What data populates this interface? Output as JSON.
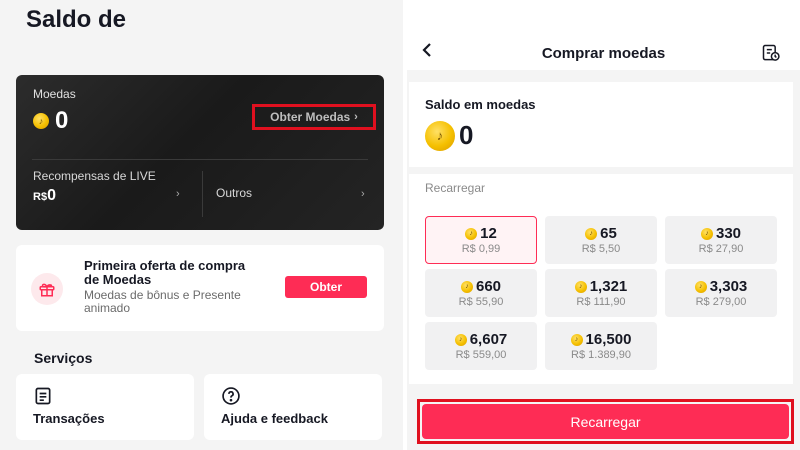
{
  "left": {
    "title": "Saldo de",
    "wallet": {
      "coins_label": "Moedas",
      "coins_value": "0",
      "get_coins_label": "Obter Moedas",
      "live_rewards_label": "Recompensas de LIVE",
      "live_rewards_currency": "R$",
      "live_rewards_value": "0",
      "others_label": "Outros"
    },
    "offer": {
      "title": "Primeira oferta de compra de Moedas",
      "subtitle": "Moedas de bônus e Presente animado",
      "button_label": "Obter"
    },
    "services": {
      "title": "Serviços",
      "items": [
        {
          "label": "Transações",
          "icon": "receipt-icon"
        },
        {
          "label": "Ajuda e feedback",
          "icon": "help-icon"
        }
      ]
    }
  },
  "right": {
    "header_title": "Comprar moedas",
    "balance": {
      "label": "Saldo em moedas",
      "value": "0"
    },
    "recharge_label": "Recarregar",
    "packages": [
      {
        "coins": "12",
        "price": "R$ 0,99",
        "selected": true
      },
      {
        "coins": "65",
        "price": "R$ 5,50"
      },
      {
        "coins": "330",
        "price": "R$ 27,90"
      },
      {
        "coins": "660",
        "price": "R$ 55,90"
      },
      {
        "coins": "1,321",
        "price": "R$ 111,90"
      },
      {
        "coins": "3,303",
        "price": "R$ 279,00"
      },
      {
        "coins": "6,607",
        "price": "R$ 559,00"
      },
      {
        "coins": "16,500",
        "price": "R$ 1.389,90"
      }
    ],
    "recharge_button_label": "Recarregar"
  },
  "colors": {
    "brand": "#fe2c55",
    "highlight": "#e0101f",
    "coin": "#f5c000"
  }
}
